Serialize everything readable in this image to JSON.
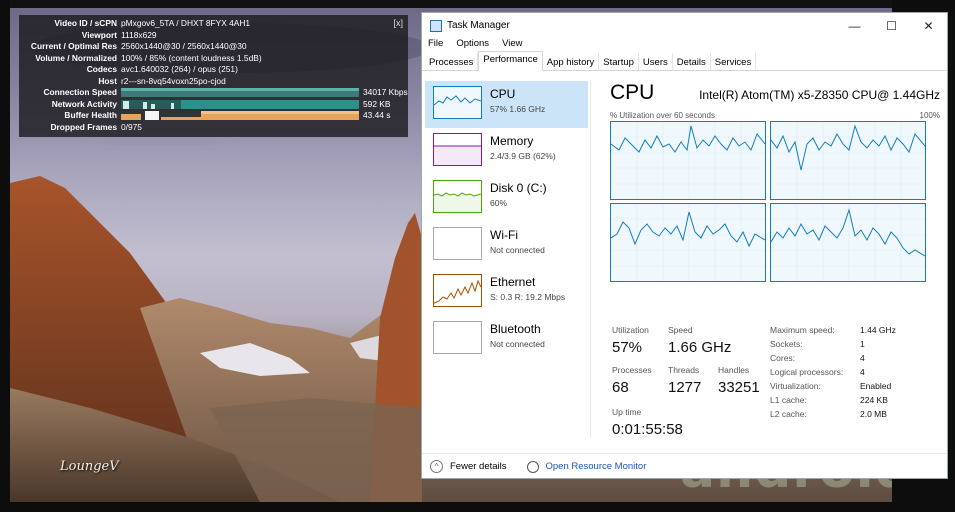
{
  "stats_overlay": {
    "close_label": "[x]",
    "rows": [
      {
        "label": "Video ID / sCPN",
        "value": "pMxgov6_5TA / DHXT 8FYX 4AH1"
      },
      {
        "label": "Viewport",
        "value": "1118x629"
      },
      {
        "label": "Current / Optimal Res",
        "value": "2560x1440@30 / 2560x1440@30"
      },
      {
        "label": "Volume / Normalized",
        "value": "100% / 85% (content loudness 1.5dB)"
      },
      {
        "label": "Codecs",
        "value": "avc1.640032 (264) / opus (251)"
      },
      {
        "label": "Host",
        "value": "r2---sn-8vq54voxn25po-cjod"
      },
      {
        "label": "Connection Speed",
        "value": "34017 Kbps"
      },
      {
        "label": "Network Activity",
        "value": "592 KB"
      },
      {
        "label": "Buffer Health",
        "value": "43.44 s"
      },
      {
        "label": "Dropped Frames",
        "value": "0/975"
      }
    ]
  },
  "video": {
    "logo_text": "LoungeV",
    "watermark_text": "androidpc"
  },
  "task_manager": {
    "title": "Task Manager",
    "window_buttons": {
      "minimize": "—",
      "maximize": "☐",
      "close": "✕"
    },
    "menu": [
      "File",
      "Options",
      "View"
    ],
    "tabs": [
      "Processes",
      "Performance",
      "App history",
      "Startup",
      "Users",
      "Details",
      "Services"
    ],
    "active_tab": "Performance",
    "sidebar": [
      {
        "name": "CPU",
        "detail": "57% 1.66 GHz",
        "color": "#117dbb"
      },
      {
        "name": "Memory",
        "detail": "2.4/3.9 GB (62%)",
        "color": "#8b12ae"
      },
      {
        "name": "Disk 0 (C:)",
        "detail": "60%",
        "color": "#4da60c"
      },
      {
        "name": "Wi-Fi",
        "detail": "Not connected",
        "color": "#aaaaaa"
      },
      {
        "name": "Ethernet",
        "detail": "S: 0.3  R: 19.2 Mbps",
        "color": "#a74f01"
      },
      {
        "name": "Bluetooth",
        "detail": "Not connected",
        "color": "#aaaaaa"
      }
    ],
    "cpu": {
      "heading": "CPU",
      "model": "Intel(R) Atom(TM) x5-Z8350 CPU@ 1.44GHz",
      "graph_label_left": "% Utilization over 60 seconds",
      "graph_label_right": "100%",
      "stats": {
        "utilization_label": "Utilization",
        "utilization": "57%",
        "speed_label": "Speed",
        "speed": "1.66 GHz",
        "processes_label": "Processes",
        "processes": "68",
        "threads_label": "Threads",
        "threads": "1277",
        "handles_label": "Handles",
        "handles": "33251",
        "uptime_label": "Up time",
        "uptime": "0:01:55:58"
      },
      "specs": [
        {
          "label": "Maximum speed:",
          "value": "1.44 GHz"
        },
        {
          "label": "Sockets:",
          "value": "1"
        },
        {
          "label": "Cores:",
          "value": "4"
        },
        {
          "label": "Logical processors:",
          "value": "4"
        },
        {
          "label": "Virtualization:",
          "value": "Enabled"
        },
        {
          "label": "L1 cache:",
          "value": "224 KB"
        },
        {
          "label": "L2 cache:",
          "value": "2.0 MB"
        }
      ]
    },
    "footer": {
      "fewer_details": "Fewer details",
      "open_resource_monitor": "Open Resource Monitor"
    }
  }
}
